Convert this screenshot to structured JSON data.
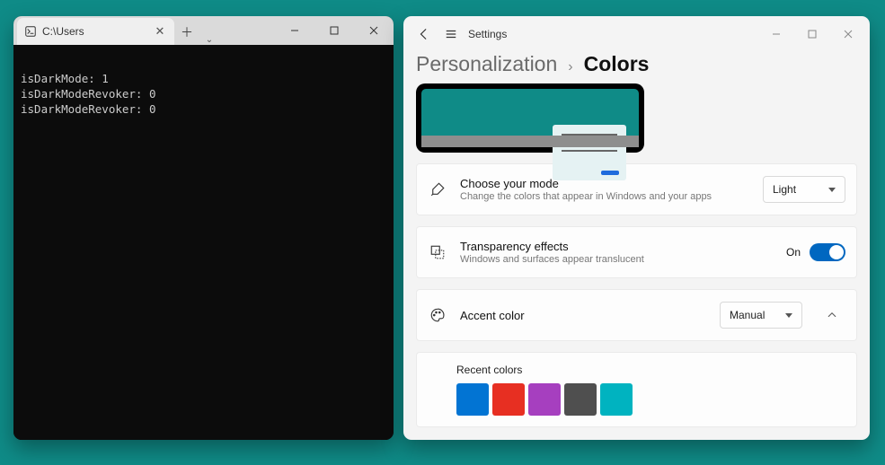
{
  "desktop": {
    "background": "#0f8b87"
  },
  "terminal": {
    "tab_title": "C:\\Users",
    "output_lines": [
      "isDarkMode: 1",
      "isDarkModeRevoker: 0",
      "isDarkModeRevoker: 0"
    ]
  },
  "settings": {
    "app_label": "Settings",
    "breadcrumb": {
      "parent": "Personalization",
      "sep": "›",
      "current": "Colors"
    },
    "mode": {
      "title": "Choose your mode",
      "subtitle": "Change the colors that appear in Windows and your apps",
      "value": "Light"
    },
    "transparency": {
      "title": "Transparency effects",
      "subtitle": "Windows and surfaces appear translucent",
      "state_label": "On",
      "enabled": true
    },
    "accent": {
      "title": "Accent color",
      "value": "Manual"
    },
    "recent_colors": {
      "title": "Recent colors",
      "swatches": [
        "#0274d3",
        "#e72f22",
        "#a63fbf",
        "#4f4f4f",
        "#00b3c0"
      ]
    }
  }
}
